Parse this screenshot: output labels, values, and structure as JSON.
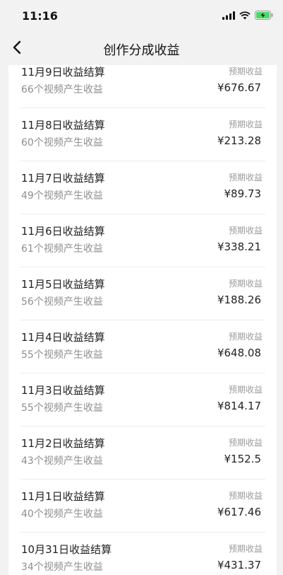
{
  "status_bar": {
    "time": "11:16",
    "icons": [
      "signal-icon",
      "wifi-icon",
      "battery-charging-icon"
    ],
    "battery_color": "#4cd964"
  },
  "nav": {
    "title": "创作分成收益",
    "back_icon": "chevron-left-icon"
  },
  "list": {
    "items": [
      {
        "title": "11月9日收益结算",
        "subtitle": "66个视频产生收益",
        "label": "预期收益",
        "amount": "¥676.67"
      },
      {
        "title": "11月8日收益结算",
        "subtitle": "60个视频产生收益",
        "label": "预期收益",
        "amount": "¥213.28"
      },
      {
        "title": "11月7日收益结算",
        "subtitle": "49个视频产生收益",
        "label": "预期收益",
        "amount": "¥89.73"
      },
      {
        "title": "11月6日收益结算",
        "subtitle": "61个视频产生收益",
        "label": "预期收益",
        "amount": "¥338.21"
      },
      {
        "title": "11月5日收益结算",
        "subtitle": "56个视频产生收益",
        "label": "预期收益",
        "amount": "¥188.26"
      },
      {
        "title": "11月4日收益结算",
        "subtitle": "55个视频产生收益",
        "label": "预期收益",
        "amount": "¥648.08"
      },
      {
        "title": "11月3日收益结算",
        "subtitle": "55个视频产生收益",
        "label": "预期收益",
        "amount": "¥814.17"
      },
      {
        "title": "11月2日收益结算",
        "subtitle": "43个视频产生收益",
        "label": "预期收益",
        "amount": "¥152.5"
      },
      {
        "title": "11月1日收益结算",
        "subtitle": "40个视频产生收益",
        "label": "预期收益",
        "amount": "¥617.46"
      },
      {
        "title": "10月31日收益结算",
        "subtitle": "34个视频产生收益",
        "label": "预期收益",
        "amount": "¥431.37"
      }
    ]
  }
}
